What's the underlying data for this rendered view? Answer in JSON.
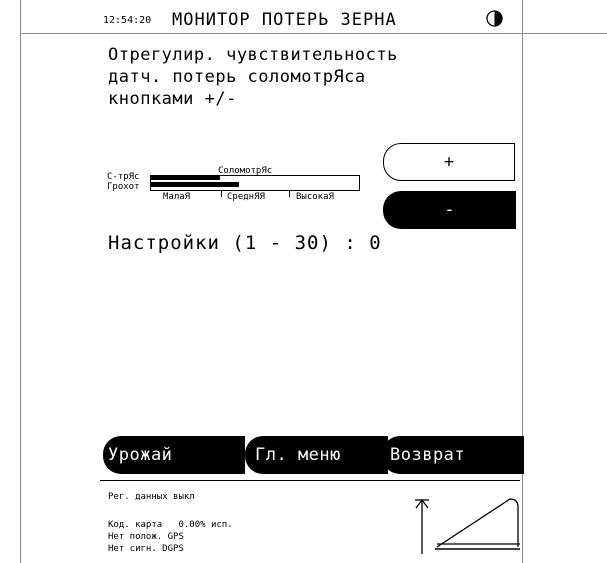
{
  "header": {
    "time": "12:54:20",
    "title": "МОНИТОР ПОТЕРЬ ЗЕРНА"
  },
  "instruction": {
    "lines": [
      "Отрегулир. чувствительность",
      "датч. потерь соломотрЯса",
      "кнопками +/-"
    ]
  },
  "sensitivity": {
    "walker_label": "СоломотрЯс",
    "shaker_label": "С-трЯс",
    "sieve_label": "Грохот",
    "scale_labels": [
      "МалаЯ",
      "СреднЯЯ",
      "ВысокаЯ"
    ],
    "shaker_level": 0.34,
    "sieve_level": 0.43
  },
  "buttons": {
    "plus": "+",
    "minus": "-"
  },
  "settings": {
    "text": "Настройки (1 - 30) : 0"
  },
  "nav": {
    "harvest": "Урожай",
    "main_menu": "Гл. меню",
    "back": "Возврат"
  },
  "status": {
    "recording": "Рег. данных выкл",
    "map": "Код. карта   0.00% исп.",
    "gps": "Нет полож. GPS",
    "dgps": "Нет сигн. DGPS"
  }
}
